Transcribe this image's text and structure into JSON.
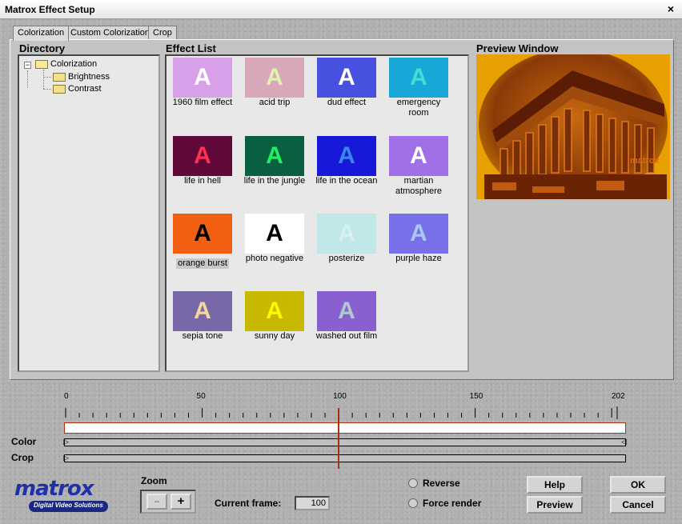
{
  "window": {
    "title": "Matrox Effect Setup",
    "close_glyph": "×"
  },
  "tabs": [
    {
      "label": "Colorization",
      "active": true
    },
    {
      "label": "Custom Colorization",
      "active": false
    },
    {
      "label": "Crop",
      "active": false
    }
  ],
  "directory": {
    "title": "Directory",
    "root": {
      "label": "Colorization",
      "expander": "−"
    },
    "children": [
      "Brightness",
      "Contrast"
    ]
  },
  "effect_list": {
    "title": "Effect List",
    "thumb_glyph": "A",
    "items": [
      {
        "label": "1960 film effect",
        "bg": "#d8a0e8",
        "fg": "#ffffff",
        "selected": false
      },
      {
        "label": "acid trip",
        "bg": "#d8a8b8",
        "fg": "#e0f0b0",
        "selected": false
      },
      {
        "label": "dud effect",
        "bg": "#4850e0",
        "fg": "#ffffff",
        "selected": false
      },
      {
        "label": "emergency room",
        "bg": "#18a8d8",
        "fg": "#40e0d0",
        "selected": false
      },
      {
        "label": "life in hell",
        "bg": "#600838",
        "fg": "#ff3050",
        "selected": false
      },
      {
        "label": "life in the jungle",
        "bg": "#086040",
        "fg": "#20f060",
        "selected": false
      },
      {
        "label": "life in the ocean",
        "bg": "#1818d8",
        "fg": "#3888f0",
        "selected": false
      },
      {
        "label": "martian atmosphere",
        "bg": "#a070e8",
        "fg": "#ffffff",
        "selected": false
      },
      {
        "label": "orange burst",
        "bg": "#f06010",
        "fg": "#000000",
        "selected": true
      },
      {
        "label": "photo negative",
        "bg": "#ffffff",
        "fg": "#000000",
        "selected": false
      },
      {
        "label": "posterize",
        "bg": "#c0e8e8",
        "fg": "#d8f0f0",
        "selected": false
      },
      {
        "label": "purple haze",
        "bg": "#7870e8",
        "fg": "#a8c8f0",
        "selected": false
      },
      {
        "label": "sepia tone",
        "bg": "#7868a8",
        "fg": "#f0d8a0",
        "selected": false
      },
      {
        "label": "sunny day",
        "bg": "#c8b800",
        "fg": "#fff800",
        "selected": false
      },
      {
        "label": "washed out film",
        "bg": "#8860d0",
        "fg": "#b0c8d0",
        "selected": false
      }
    ]
  },
  "preview": {
    "title": "Preview Window",
    "watermark": "matrox"
  },
  "timeline": {
    "ruler_labels": [
      "0",
      "50",
      "100",
      "150",
      "202"
    ],
    "ruler_values": [
      0,
      50,
      100,
      150,
      202
    ],
    "max_frame": 202,
    "current_frame": 100,
    "rows": [
      "Color",
      "Crop"
    ]
  },
  "logo": {
    "brand": "matrox",
    "tagline": "Digital Video Solutions"
  },
  "zoom": {
    "label": "Zoom",
    "minus": "−",
    "plus": "+"
  },
  "current_frame": {
    "label": "Current frame:",
    "value": "100"
  },
  "options": {
    "reverse": "Reverse",
    "force_render": "Force render"
  },
  "buttons": {
    "help": "Help",
    "ok": "OK",
    "preview": "Preview",
    "cancel": "Cancel"
  }
}
